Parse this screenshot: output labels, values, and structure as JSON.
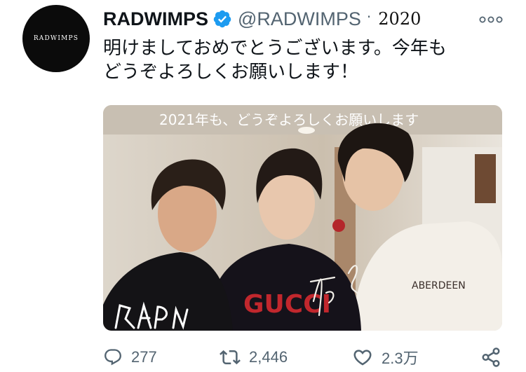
{
  "profile": {
    "avatar_text": "RADWIMPS",
    "display_name": "RADWIMPS",
    "handle": "@RADWIMPS",
    "separator": "·",
    "year": "2020"
  },
  "tweet": {
    "line1": "明けましておめでとうございます。今年も",
    "line2": "どうぞよろしくお願いします！"
  },
  "photo": {
    "handwritten_text": "2021年も、どうぞよろしくお願いします",
    "sweatshirt_text": "GUCCI",
    "tshirt_text": "ABERDEEN"
  },
  "actions": {
    "reply_count": "277",
    "retweet_count": "2,446",
    "like_count": "2.3万"
  },
  "icons": {
    "verified": "verified-badge-icon",
    "more": "more-options-icon",
    "reply": "reply-icon",
    "retweet": "retweet-icon",
    "like": "heart-icon",
    "share": "share-icon"
  },
  "colors": {
    "verified_blue": "#1d9bf0",
    "secondary_text": "#536471",
    "primary_text": "#0f1419"
  }
}
